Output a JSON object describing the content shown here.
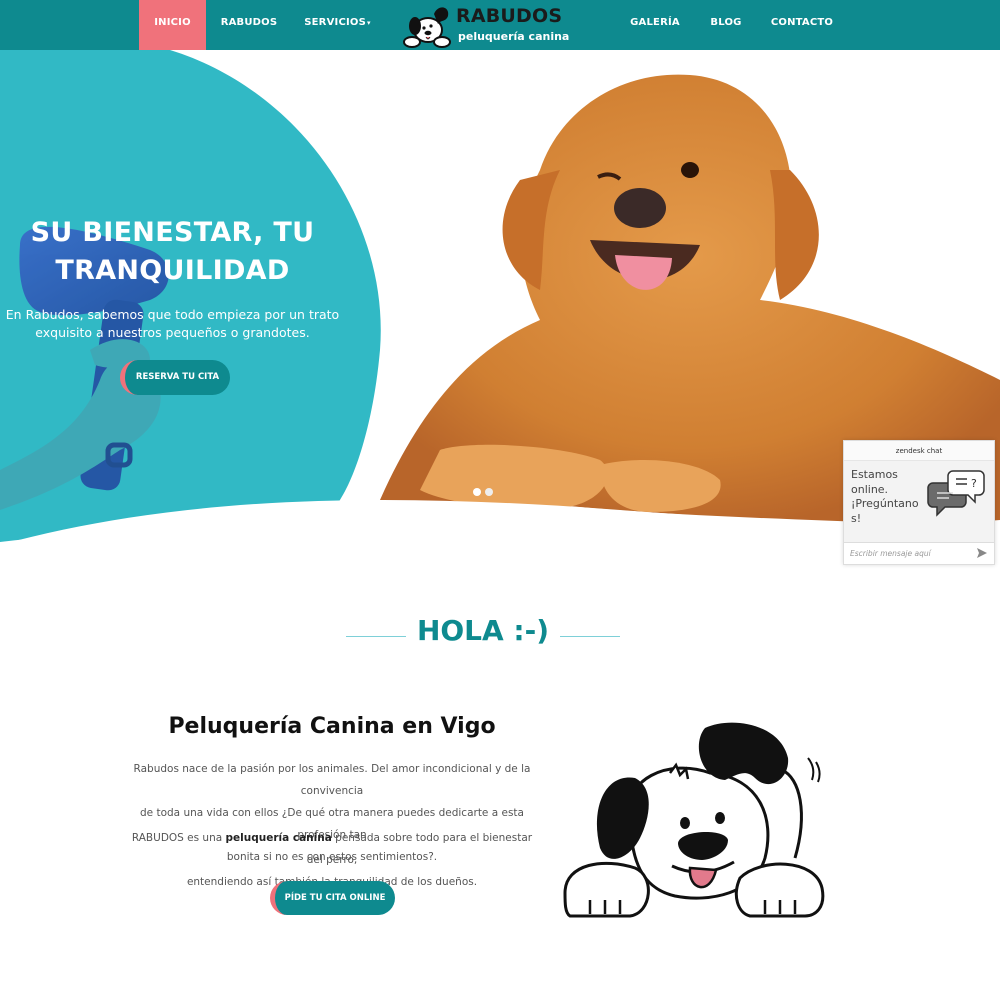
{
  "nav": {
    "items": [
      {
        "label": "INICIO",
        "active": true
      },
      {
        "label": "RABUDOS"
      },
      {
        "label": "SERVICIOS",
        "has_dropdown": true
      },
      {
        "label": "GALERÍA"
      },
      {
        "label": "BLOG"
      },
      {
        "label": "CONTACTO"
      }
    ],
    "caret_icon": "chevron-down-icon",
    "logo": {
      "title": "RABUDOS",
      "subtitle": "peluquería canina",
      "icon": "cartoon-dog-icon"
    }
  },
  "hero": {
    "title_line1": "SU BIENESTAR, TU",
    "title_line2": "TRANQUILIDAD",
    "text_line1": "En Rabudos, sabemos que todo empieza por un trato",
    "text_line2": "exquisito a nuestros pequeños o grandotes.",
    "button": "RESERVA TU CITA",
    "slides": 2,
    "active_slide": 1
  },
  "chat": {
    "header": "zendesk chat",
    "message_line1": "Estamos",
    "message_line2": "online.",
    "message_line3": "¡Pregúntano",
    "message_line4": "s!",
    "input_placeholder": "Escribir mensaje aquí",
    "icon": "chat-bubbles-icon",
    "send_icon": "send-arrow-icon"
  },
  "hola": {
    "title": "HOLA :-)"
  },
  "about": {
    "title": "Peluquería Canina en Vigo",
    "p1_line1": "Rabudos nace de la pasión por los animales. Del amor incondicional y de la convivencia",
    "p1_line2": "de toda una vida con ellos ¿De qué otra manera puedes dedicarte a esta profesión tan",
    "p1_line3": "bonita si no es con estos sentimientos?.",
    "p2_before": "RABUDOS es una ",
    "p2_bold": "peluquería canina",
    "p2_after": " pensada sobre todo para el bienestar del perro,",
    "p2_line2": "entendiendo así también la tranquilidad de los dueños.",
    "button": "PÍDE TU CITA ONLINE",
    "illustration": "cartoon-dog-illustration"
  },
  "colors": {
    "teal": "#0e8a8f",
    "hero_teal": "#2ab7c3",
    "pink": "#f0727b",
    "dog_gold": "#d9893c"
  }
}
